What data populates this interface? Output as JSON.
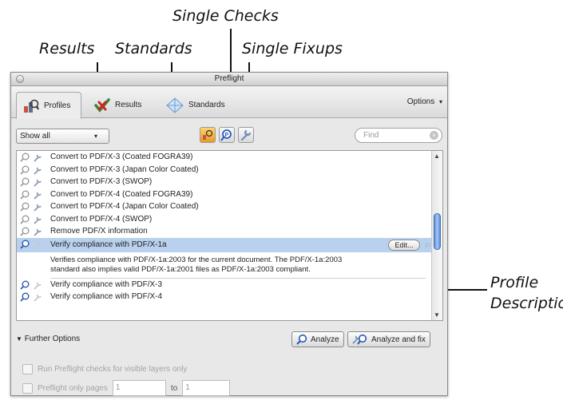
{
  "callouts": {
    "single_checks": "Single Checks",
    "results": "Results",
    "standards": "Standards",
    "single_fixups": "Single Fixups",
    "profile_description_line1": "Profile",
    "profile_description_line2": "Description"
  },
  "window": {
    "title": "Preflight",
    "tabs": [
      "Profiles",
      "Results",
      "Standards"
    ],
    "options_label": "Options"
  },
  "toolbar": {
    "filter_value": "Show all",
    "search_placeholder": "Find"
  },
  "profiles": [
    "Convert to PDF/X-3 (Coated FOGRA39)",
    "Convert to PDF/X-3 (Japan Color Coated)",
    "Convert to PDF/X-3 (SWOP)",
    "Convert to PDF/X-4 (Coated FOGRA39)",
    "Convert to PDF/X-4 (Japan Color Coated)",
    "Convert to PDF/X-4 (SWOP)",
    "Remove PDF/X information"
  ],
  "selected_profile": {
    "label": "Verify compliance with PDF/X-1a",
    "edit_label": "Edit...",
    "description_line1": "Verifies compliance with PDF/X-1a:2003 for the current document. The PDF/X-1a:2003",
    "description_line2": "standard also implies valid PDF/X-1a:2001 files as PDF/X-1a:2003 compliant."
  },
  "after_profiles": [
    "Verify compliance with PDF/X-3",
    "Verify compliance with PDF/X-4"
  ],
  "further_options": {
    "label": "Further Options",
    "analyze": "Analyze",
    "analyze_fix": "Analyze and fix",
    "visible_layers": "Run Preflight checks for visible layers only",
    "pages_label": "Preflight only pages",
    "page_from": "1",
    "to_label": "to",
    "page_to": "1"
  },
  "colors": {
    "selection": "#b9d1ee",
    "scroll_thumb": "#5d8fd8"
  }
}
